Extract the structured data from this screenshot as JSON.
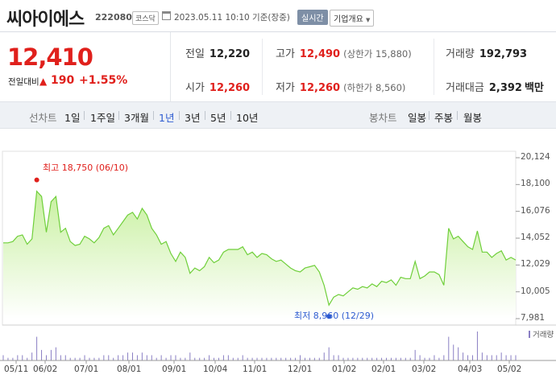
{
  "header": {
    "stock_name": "씨아이에스",
    "stock_code": "222080",
    "market_badge": "코스닥",
    "date_text": "2023.05.11 10:10 기준(장중)",
    "realtime_label": "실시간",
    "corp_button_label": "기업개요",
    "icons": {
      "calendar": "calendar-icon",
      "dropdown": "chevron-down-icon"
    }
  },
  "price": {
    "current": "12,410",
    "change_label": "전일대비",
    "change_direction_icon": "up-triangle-icon",
    "change_value": "190",
    "change_rate": "+1.55%"
  },
  "stats": {
    "prev_label": "전일",
    "prev_value": "12,220",
    "open_label": "시가",
    "open_value": "12,260",
    "high_label": "고가",
    "high_value": "12,490",
    "upper_limit": "(상한가 15,880)",
    "low_label": "저가",
    "low_value": "12,260",
    "lower_limit": "(하한가 8,560)",
    "volume_label": "거래량",
    "volume_value": "192,793",
    "amount_label": "거래대금",
    "amount_value": "2,392",
    "amount_unit": "백만"
  },
  "tabs": {
    "line_chart_label": "선차트",
    "periods": [
      "1일",
      "1주일",
      "3개월",
      "1년",
      "3년",
      "5년",
      "10년"
    ],
    "active_period": "1년",
    "candle_chart_label": "봉차트",
    "candle_periods": [
      "일봉",
      "주봉",
      "월봉"
    ]
  },
  "colors": {
    "up": "#e0201c",
    "down": "#2d5bd1",
    "line": "#6fcf3a",
    "fill_top": "#c8f0a0",
    "volume": "#8a7fc4"
  },
  "chart_data": {
    "type": "area",
    "y_ticks": [
      "20,124",
      "18,100",
      "16,076",
      "14,052",
      "12,029",
      "10,005",
      "7,981"
    ],
    "ylim": [
      7981,
      20124
    ],
    "x_ticks": [
      "05/11",
      "06/02",
      "07/01",
      "08/01",
      "09/01",
      "10/04",
      "11/01",
      "12/01",
      "01/02",
      "02/01",
      "03/02",
      "04/03",
      "05/02"
    ],
    "high_annotation": "최고 18,750 (06/10)",
    "low_annotation": "최저 8,960 (12/29)",
    "volume_legend": "거래량",
    "series": [
      {
        "values": [
          13700,
          13700,
          13800,
          14200,
          14300,
          13600,
          14000,
          17600,
          17200,
          14500,
          16800,
          17200,
          14500,
          14800,
          13800,
          13500,
          13600,
          14200,
          14000,
          13700,
          14100,
          14800,
          15000,
          14300,
          14800,
          15300,
          15800,
          16000,
          15500,
          16300,
          15800,
          14800,
          14300,
          13600,
          13800,
          12900,
          12300,
          13000,
          12600,
          11400,
          11800,
          11600,
          11900,
          12600,
          12200,
          12400,
          13000,
          13200,
          13200,
          13200,
          13400,
          12800,
          13000,
          12600,
          12900,
          12800,
          12500,
          12300,
          12400,
          12100,
          11800,
          11600,
          11500,
          11800,
          11900,
          12000,
          11500,
          10500,
          9000,
          9600,
          9800,
          9700,
          10000,
          10300,
          10200,
          10400,
          10300,
          10600,
          10400,
          10800,
          10700,
          10900,
          10500,
          11100,
          11000,
          11000,
          12300,
          11000,
          11200,
          11500,
          11500,
          11300,
          10500,
          14800,
          14000,
          14200,
          13800,
          13400,
          13200,
          14600,
          13000,
          13000,
          12600,
          12900,
          13100,
          12400,
          12600,
          12410
        ],
        "volumes": [
          2,
          1,
          1,
          2,
          2,
          1,
          3,
          9,
          4,
          2,
          4,
          5,
          2,
          2,
          1,
          1,
          1,
          2,
          1,
          1,
          1,
          2,
          2,
          1,
          2,
          2,
          3,
          3,
          2,
          3,
          2,
          2,
          1,
          2,
          1,
          2,
          2,
          1,
          1,
          3,
          1,
          1,
          1,
          2,
          1,
          1,
          2,
          2,
          1,
          1,
          2,
          1,
          1,
          1,
          1,
          1,
          1,
          1,
          1,
          1,
          1,
          1,
          2,
          1,
          1,
          1,
          1,
          3,
          5,
          2,
          2,
          1,
          1,
          1,
          1,
          1,
          1,
          1,
          1,
          1,
          1,
          1,
          1,
          1,
          1,
          1,
          4,
          2,
          1,
          1,
          2,
          1,
          2,
          9,
          6,
          5,
          3,
          2,
          2,
          11,
          3,
          2,
          2,
          2,
          3,
          2,
          2,
          2
        ]
      }
    ]
  }
}
